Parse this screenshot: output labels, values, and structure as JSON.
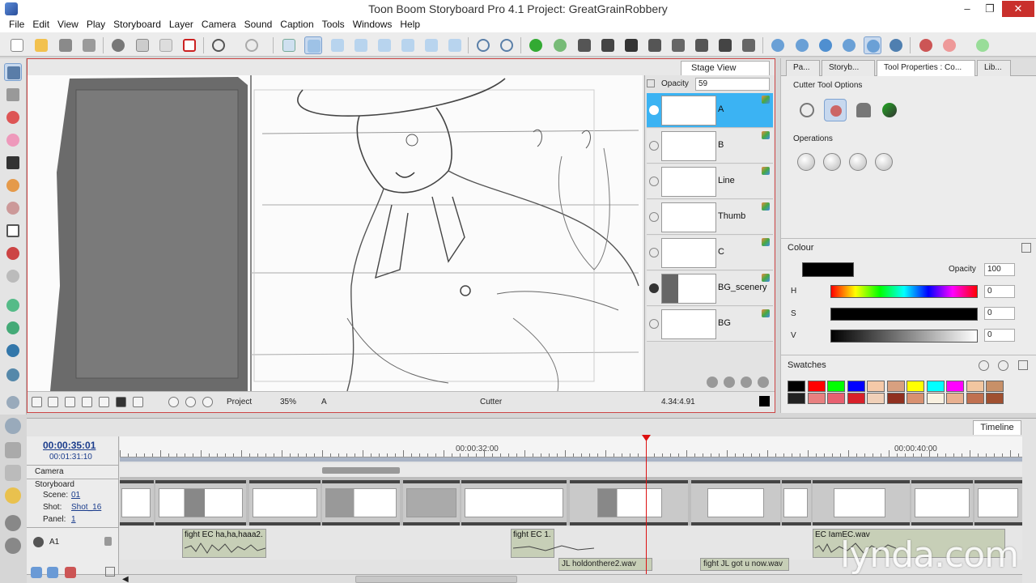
{
  "window": {
    "title": "Toon Boom Storyboard Pro 4.1 Project: GreatGrainRobbery",
    "minimize": "–",
    "restore": "❐",
    "close": "✕"
  },
  "menu": [
    "File",
    "Edit",
    "View",
    "Play",
    "Storyboard",
    "Layer",
    "Camera",
    "Sound",
    "Caption",
    "Tools",
    "Windows",
    "Help"
  ],
  "stage": {
    "tab_label": "Stage View",
    "opacity_label": "Opacity",
    "opacity_value": "59",
    "layers": [
      {
        "name": "A",
        "selected": true
      },
      {
        "name": "B",
        "selected": false
      },
      {
        "name": "Line",
        "selected": false
      },
      {
        "name": "Thumb",
        "selected": false
      },
      {
        "name": "C",
        "selected": false
      },
      {
        "name": "BG_scenery",
        "selected": false
      },
      {
        "name": "BG",
        "selected": false
      }
    ],
    "status": {
      "view_mode": "Project",
      "zoom": "35%",
      "current_layer": "A",
      "tool": "Cutter",
      "coords": "4.34:4.91"
    }
  },
  "right_panel": {
    "tabs": [
      "Pa...",
      "Storyb...",
      "Tool Properties : Co...",
      "Lib..."
    ],
    "cutter_title": "Cutter Tool Options",
    "operations_title": "Operations",
    "colour_title": "Colour",
    "colour_opacity_label": "Opacity",
    "colour_opacity_value": "100",
    "h_label": "H",
    "h_value": "0",
    "s_label": "S",
    "s_value": "0",
    "v_label": "V",
    "v_value": "0",
    "swatches_title": "Swatches",
    "current_colour": "#000000",
    "swatch_row1": [
      "#000000",
      "#ff0000",
      "#00ff00",
      "#0000ff",
      "#f5c9a8",
      "#d8a080",
      "#ffff00",
      "#00ffff",
      "#ff00ff",
      "#f2c6a0",
      "#c89068"
    ],
    "swatch_row2": [
      "#222222",
      "#e88080",
      "#e86070",
      "#d8202a",
      "#f0d0b8",
      "#903020",
      "#d89070",
      "#f8f0e0",
      "#e8b090",
      "#c07050",
      "#a05030"
    ]
  },
  "timeline": {
    "tab_label": "Timeline",
    "current_time": "00:00:35:01",
    "total_time": "00:01:31:10",
    "ruler_labels": [
      "00:00:32:00",
      "00:00:40:00"
    ],
    "camera_label": "Camera",
    "storyboard_label": "Storyboard",
    "scene_label": "Scene:",
    "scene_value": "01",
    "shot_label": "Shot:",
    "shot_value": "Shot_16",
    "panel_label": "Panel:",
    "panel_value": "1",
    "audio_track": "A1",
    "audio_clips": [
      "fight EC ha,ha,haaa2.",
      "fight EC 1.",
      "EC IamEC.wav",
      "JL holdonthere2.wav",
      "fight JL got u now.wav"
    ]
  },
  "watermark": "lynda.com",
  "colors": {
    "accent_blue": "#3bb3f3",
    "playhead": "#dd1111",
    "stage_border": "#cc4444"
  }
}
